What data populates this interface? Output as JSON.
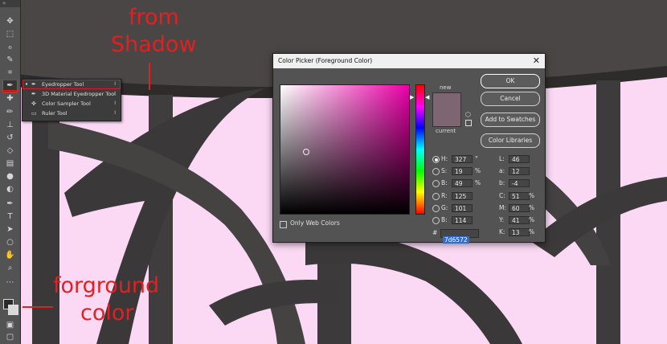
{
  "annotations": {
    "from_shadow_1": "from",
    "from_shadow_2": "Shadow",
    "foreground_1": "forground",
    "foreground_2": "color"
  },
  "toolbar": {
    "header": "»",
    "tools": [
      {
        "name": "move-tool-icon",
        "glyph": "✥"
      },
      {
        "name": "marquee-tool-icon",
        "glyph": "⬚"
      },
      {
        "name": "lasso-tool-icon",
        "glyph": "ℴ"
      },
      {
        "name": "quick-select-tool-icon",
        "glyph": "✎"
      },
      {
        "name": "crop-tool-icon",
        "glyph": "⌗"
      },
      {
        "name": "eyedropper-tool-icon",
        "glyph": "✒"
      },
      {
        "name": "healing-brush-tool-icon",
        "glyph": "✚"
      },
      {
        "name": "brush-tool-icon",
        "glyph": "✏"
      },
      {
        "name": "stamp-tool-icon",
        "glyph": "⊥"
      },
      {
        "name": "history-brush-tool-icon",
        "glyph": "↺"
      },
      {
        "name": "eraser-tool-icon",
        "glyph": "◇"
      },
      {
        "name": "gradient-tool-icon",
        "glyph": "▤"
      },
      {
        "name": "blur-tool-icon",
        "glyph": "●"
      },
      {
        "name": "dodge-tool-icon",
        "glyph": "◐"
      },
      {
        "name": "pen-tool-icon",
        "glyph": "✒"
      },
      {
        "name": "type-tool-icon",
        "glyph": "T"
      },
      {
        "name": "path-select-tool-icon",
        "glyph": "➤"
      },
      {
        "name": "shape-tool-icon",
        "glyph": "○"
      },
      {
        "name": "hand-tool-icon",
        "glyph": "✋"
      },
      {
        "name": "zoom-tool-icon",
        "glyph": "⌕"
      },
      {
        "name": "more-tools-icon",
        "glyph": "⋯"
      }
    ]
  },
  "flyout": {
    "items": [
      {
        "label": "Eyedropper Tool",
        "key": "I",
        "icon": "eyedropper-icon",
        "glyph": "✒",
        "selected": true
      },
      {
        "label": "3D Material Eyedropper Tool",
        "key": "I",
        "icon": "3d-eyedropper-icon",
        "glyph": "✒",
        "selected": false
      },
      {
        "label": "Color Sampler Tool",
        "key": "I",
        "icon": "color-sampler-icon",
        "glyph": "✜",
        "selected": false
      },
      {
        "label": "Ruler Tool",
        "key": "I",
        "icon": "ruler-icon",
        "glyph": "▭",
        "selected": false
      }
    ]
  },
  "dialog": {
    "title": "Color Picker (Foreground Color)",
    "close": "✕",
    "new_label": "new",
    "current_label": "current",
    "swatch_color": "#7d6572",
    "buttons": {
      "ok": "OK",
      "cancel": "Cancel",
      "add_to_swatches": "Add to Swatches",
      "color_libraries": "Color Libraries"
    },
    "only_web_colors": "Only Web Colors",
    "hsb": [
      {
        "label": "H:",
        "value": "327",
        "unit": "°",
        "selected": true
      },
      {
        "label": "S:",
        "value": "19",
        "unit": "%",
        "selected": false
      },
      {
        "label": "B:",
        "value": "49",
        "unit": "%",
        "selected": false
      }
    ],
    "rgb": [
      {
        "label": "R:",
        "value": "125"
      },
      {
        "label": "G:",
        "value": "101"
      },
      {
        "label": "B:",
        "value": "114"
      }
    ],
    "lab": [
      {
        "label": "L:",
        "value": "46"
      },
      {
        "label": "a:",
        "value": "12"
      },
      {
        "label": "b:",
        "value": "-4"
      }
    ],
    "cmyk": [
      {
        "label": "C:",
        "value": "51",
        "unit": "%"
      },
      {
        "label": "M:",
        "value": "60",
        "unit": "%"
      },
      {
        "label": "Y:",
        "value": "41",
        "unit": "%"
      },
      {
        "label": "K:",
        "value": "13",
        "unit": "%"
      }
    ],
    "hex_label": "#",
    "hex_value": "7d6572"
  }
}
